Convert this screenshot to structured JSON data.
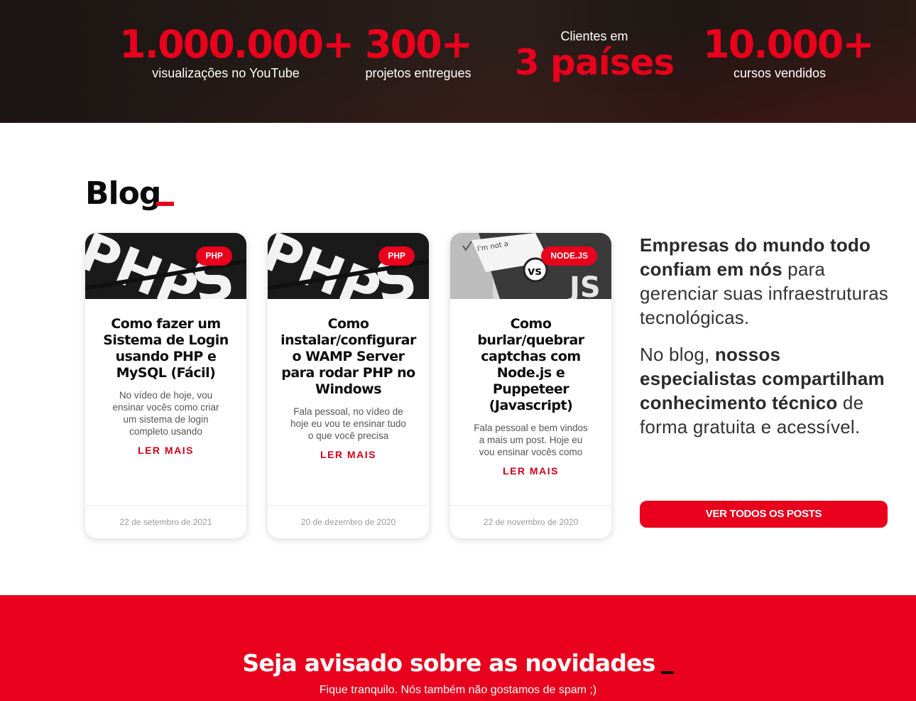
{
  "stats": [
    {
      "value": "1.000.000+",
      "label": "visualizações no YouTube"
    },
    {
      "value": "300+",
      "label": "projetos entregues"
    },
    {
      "prefix": "Clientes em",
      "value": "3 países"
    },
    {
      "value": "10.000+",
      "label": "cursos vendidos"
    }
  ],
  "blog": {
    "title": "Blog",
    "posts": [
      {
        "tag": "PHP",
        "image_icon": "php-keyboard-image",
        "title": "Como fazer um Sistema de Login usando PHP e MySQL (Fácil)",
        "excerpt": "No vídeo de hoje, vou ensinar vocês como criar um sistema de login completo usando",
        "read_more": "LER MAIS",
        "date": "22 de setembro de 2021"
      },
      {
        "tag": "PHP",
        "image_icon": "php-keyboard-image",
        "title": "Como instalar/configurar o WAMP Server para rodar PHP no Windows",
        "excerpt": "Fala pessoal, no vídeo de hoje eu vou te ensinar tudo o que você precisa",
        "read_more": "LER MAIS",
        "date": "20 de dezembro de 2020"
      },
      {
        "tag": "NODE.JS",
        "image_icon": "captcha-vs-image",
        "image_text": "I'm not a",
        "title": "Como burlar/quebrar captchas com Node.js e Puppeteer (Javascript)",
        "excerpt": "Fala pessoal e bem vindos a mais um post. Hoje eu vou ensinar vocês como",
        "read_more": "LER MAIS",
        "date": "22 de novembro de 2020"
      }
    ],
    "side": {
      "p1_bold": "Empresas do mundo todo confiam em nós",
      "p1_rest": " para gerenciar suas infraestruturas tecnológicas.",
      "p2_start": "No blog, ",
      "p2_bold": "nossos especialistas compartilham conhecimento técnico",
      "p2_rest": " de forma gratuita e acessível."
    },
    "cta": "VER TODOS OS POSTS"
  },
  "newsletter": {
    "title": "Seja avisado sobre as novidades",
    "subtitle": "Fique tranquilo. Nós também não gostamos de spam ;)"
  },
  "colors": {
    "accent": "#e8001c",
    "dark_band": "#1f1815",
    "text_dark": "#0c0c0c"
  }
}
